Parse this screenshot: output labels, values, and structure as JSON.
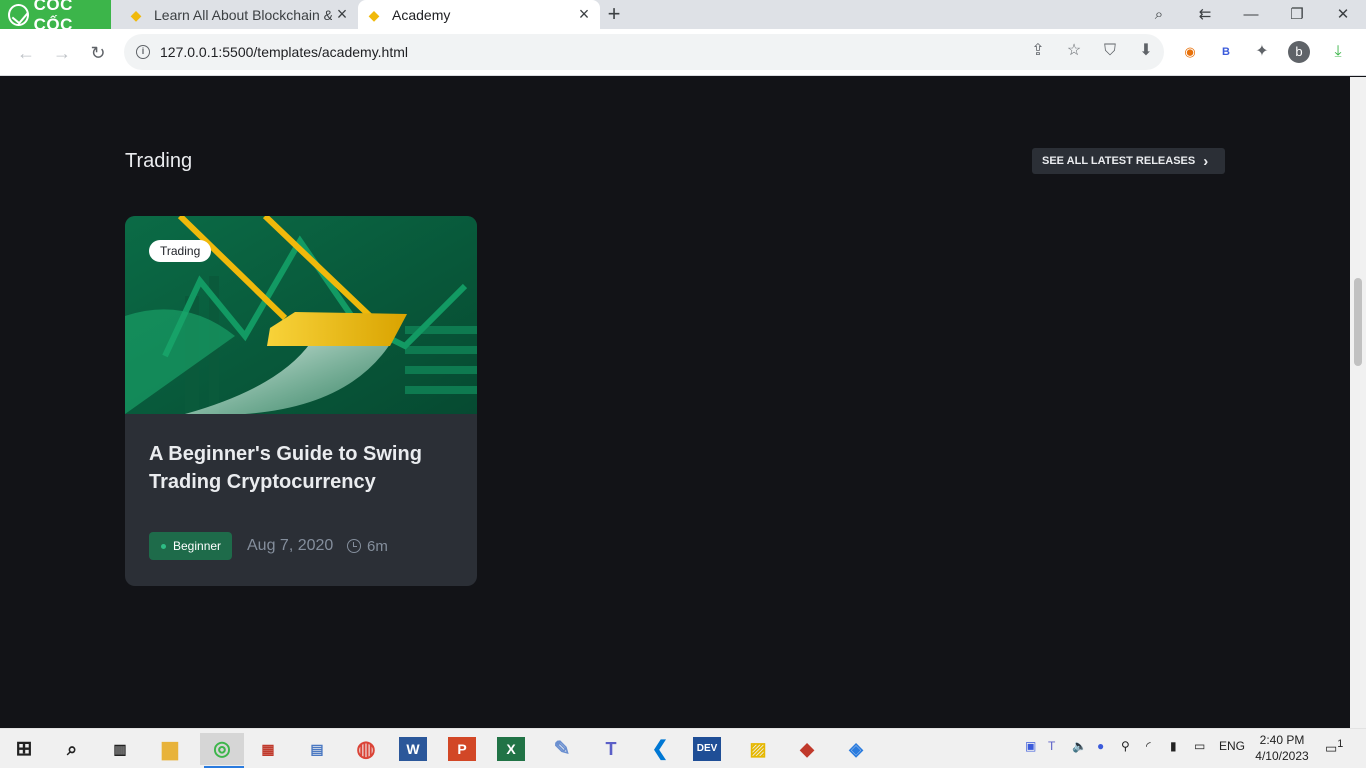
{
  "browser": {
    "brand": "CỐC CỐC",
    "tabs": [
      {
        "title": "Learn All About Blockchain & ",
        "active": false
      },
      {
        "title": "Academy",
        "active": true
      }
    ],
    "new_tab": "+",
    "address": "127.0.0.1:5500/templates/academy.html",
    "avatar_letter": "b",
    "ext_b": "B"
  },
  "section": {
    "title": "Trading",
    "see_all_label": "SEE ALL LATEST RELEASES"
  },
  "article": {
    "tag": "Trading",
    "title": "A Beginner's Guide to Swing Trading Cryptocurrency",
    "level": "Beginner",
    "date": "Aug 7, 2020",
    "duration": "6m"
  },
  "taskbar": {
    "apps": [
      "start-icon",
      "search-icon",
      "task-view-icon",
      "file-explorer-icon",
      "coccoc-icon",
      "app-icon",
      "app-icon",
      "chrome-icon",
      "word-icon",
      "powerpoint-icon",
      "excel-icon",
      "paint-icon",
      "teams-icon",
      "vscode-icon",
      "devc-icon",
      "app-icon",
      "app-icon",
      "app-icon"
    ],
    "language": "ENG",
    "time": "2:40 PM",
    "date": "4/10/2023",
    "notif_count": "1"
  },
  "colors": {
    "page_bg": "#121317",
    "card_bg": "#2b2f36",
    "brand_green": "#3cb54a",
    "binance_yellow": "#f0b90b",
    "level_badge": "#1e6b4a"
  }
}
